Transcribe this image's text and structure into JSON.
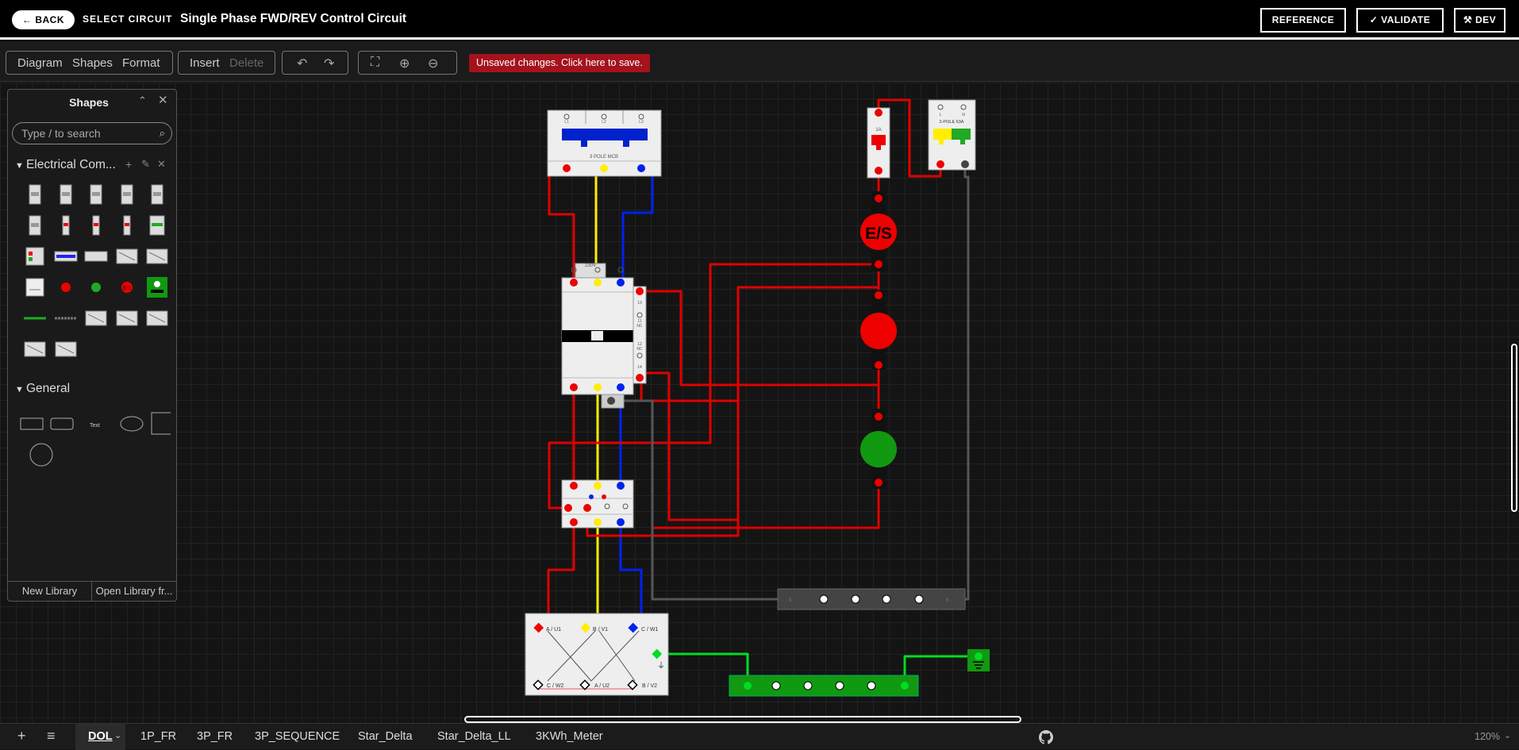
{
  "header": {
    "back_label": "← BACK",
    "select_circuit_label": "SELECT CIRCUIT",
    "title": "Single Phase FWD/REV Control Circuit",
    "reference_label": "REFERENCE",
    "validate_label": "✓ VALIDATE",
    "dev_label": "⚒ DEV"
  },
  "toolbar": {
    "menu": [
      "Diagram",
      "Shapes",
      "Format"
    ],
    "insert_label": "Insert",
    "delete_label": "Delete",
    "undo_icon": "↶",
    "redo_icon": "↷",
    "fit_icon": "⛶",
    "zoom_in_icon": "⊕",
    "zoom_out_icon": "⊖",
    "save_banner": "Unsaved changes. Click here to save."
  },
  "shapes_panel": {
    "title": "Shapes",
    "search_placeholder": "Type / to search",
    "library_name": "Electrical Com...",
    "general_name": "General",
    "general_text_shape": "Text",
    "new_library_label": "New Library",
    "open_library_label": "Open Library fr..."
  },
  "diagram": {
    "mcb3_label": "3 POLE MCB",
    "mcb3_terminals": [
      "L1",
      "L2",
      "L3"
    ],
    "mcb1_rating": "1A",
    "mcb2_label": "2-POLE 63A",
    "mcb2_terminals": [
      "L",
      "N"
    ],
    "contactor_label": "230V",
    "contactor_aux": [
      "13",
      "11",
      "NC",
      "12",
      "NC",
      "14"
    ],
    "es_button_label": "E/S",
    "motor_terminals_top": [
      "A / U1",
      "B / V1",
      "C / W1"
    ],
    "motor_terminals_bottom": [
      "C / W2",
      "A / U2",
      "B / V2"
    ],
    "colors": {
      "red": "#e00000",
      "yellow": "#ffee00",
      "blue": "#0022ee",
      "green": "#00dd22",
      "grey": "#555555"
    }
  },
  "bottom_tabs": {
    "add_icon": "+",
    "menu_icon": "≡",
    "tabs": [
      "DOL",
      "1P_FR",
      "3P_FR",
      "3P_SEQUENCE",
      "Star_Delta",
      "Star_Delta_LL",
      "3KWh_Meter"
    ],
    "active_tab": "DOL",
    "github_icon": "github-icon",
    "zoom_level": "120%"
  }
}
